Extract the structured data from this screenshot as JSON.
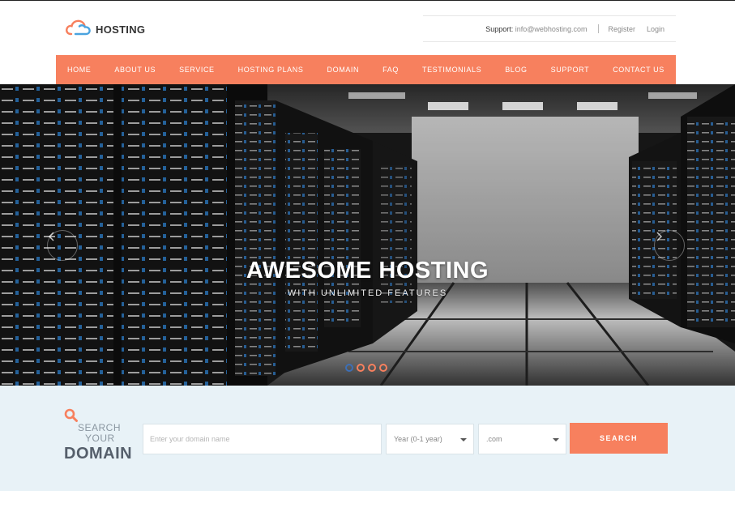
{
  "brand": {
    "name": "HOSTING",
    "icon": "cloud-icon",
    "icon_colors": [
      "#f7805e",
      "#4aa3df"
    ]
  },
  "topbar": {
    "support_label": "Support:",
    "support_email": "info@webhosting.com",
    "register": "Register",
    "login": "Login"
  },
  "nav": {
    "items": [
      "HOME",
      "ABOUT US",
      "SERVICE",
      "HOSTING PLANS",
      "DOMAIN",
      "FAQ",
      "TESTIMONIALS",
      "BLOG",
      "SUPPORT",
      "CONTACT US"
    ],
    "bg_color": "#f7805e"
  },
  "hero": {
    "title": "AWESOME HOSTING",
    "subtitle": "WITH UNLIMITED FEATURES",
    "prev_icon": "chevron-left-icon",
    "next_icon": "chevron-right-icon",
    "slide_count": 4,
    "active_slide": 1
  },
  "search": {
    "label_line1": "SEARCH",
    "label_line2": "YOUR",
    "label_line3": "DOMAIN",
    "icon": "search-icon",
    "placeholder": "Enter your domain name",
    "year_selected": "Year (0-1 year)",
    "tld_selected": ".com",
    "button": "SEARCH"
  },
  "colors": {
    "accent": "#f7805e",
    "band": "#e8f2f7",
    "slider_active": "#3d6fb5"
  }
}
